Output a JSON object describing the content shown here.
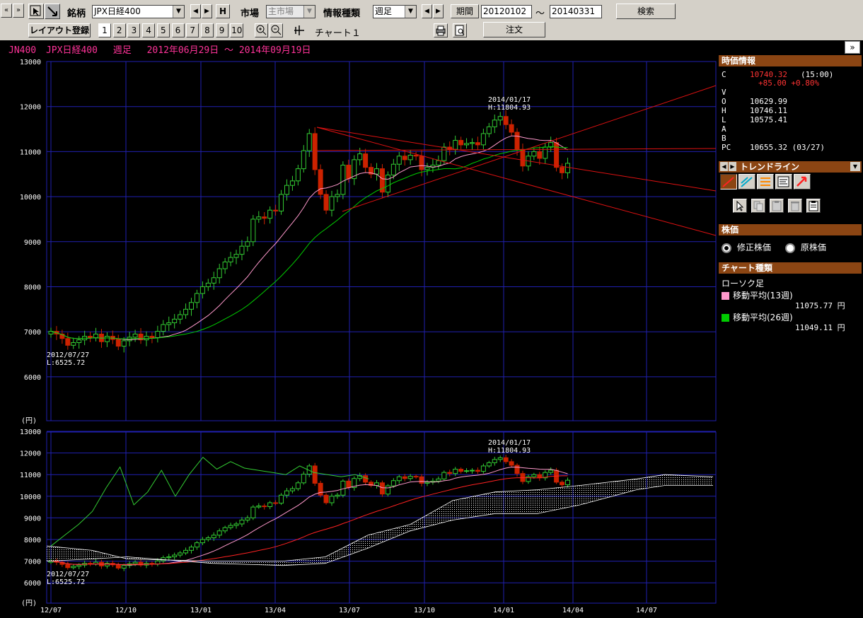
{
  "toolbar1": {
    "brand_label": "銘柄",
    "brand_value": "JPX日経400",
    "h_button": "H",
    "market_label": "市場",
    "market_value": "主市場",
    "info_label": "情報種類",
    "info_value": "週足",
    "period_label": "期間",
    "from_date": "20120102",
    "tilde": "～",
    "to_date": "20140331",
    "search_button": "検索"
  },
  "toolbar2": {
    "layout_button": "レイアウト登録",
    "layout_numbers": [
      "1",
      "2",
      "3",
      "4",
      "5",
      "6",
      "7",
      "8",
      "9",
      "10"
    ],
    "chart_label": "チャート１",
    "order_button": "注文"
  },
  "chart_header": {
    "code": "JN400",
    "name": "JPX日経400",
    "period_type": "週足",
    "date_range": "2012年06月29日 ～ 2014年09月19日"
  },
  "main_chart": {
    "y_ticks": [
      "13000",
      "12000",
      "11000",
      "10000",
      "9000",
      "8000",
      "7000",
      "6000"
    ],
    "unit": "(円)",
    "high_annotation_date": "2014/01/17",
    "high_annotation_value": "H:11804.93",
    "low_annotation_date": "2012/07/27",
    "low_annotation_value": "L:6525.72"
  },
  "sub_chart": {
    "y_ticks": [
      "13000",
      "12000",
      "11000",
      "10000",
      "9000",
      "8000",
      "7000",
      "6000"
    ],
    "unit": "(円)",
    "high_annotation_date": "2014/01/17",
    "high_annotation_value": "H:11804.93",
    "low_annotation_date": "2012/07/27",
    "low_annotation_value": "L:6525.72"
  },
  "x_axis": [
    "12/07",
    "12/10",
    "13/01",
    "13/04",
    "13/07",
    "13/10",
    "14/01",
    "14/04",
    "14/07"
  ],
  "right_panel": {
    "quote_header": "時価情報",
    "quote": {
      "c_label": "C",
      "c_value": "10740.32",
      "c_time": "(15:00)",
      "change": "+85.00 +0.80%",
      "v_label": "V",
      "o_label": "O",
      "o_value": "10629.99",
      "h_label": "H",
      "h_value": "10746.11",
      "l_label": "L",
      "l_value": "10575.41",
      "a_label": "A",
      "b_label": "B",
      "pc_label": "PC",
      "pc_value": "10655.32 (03/27)"
    },
    "trendline_header": "トレンドライン",
    "stock_price_header": "株価",
    "radio_adjusted": "修正株価",
    "radio_original": "原株価",
    "chart_type_header": "チャート種類",
    "candle_label": "ローソク足",
    "ma13_label": "移動平均(13週)",
    "ma13_value": "11075.77 円",
    "ma26_label": "移動平均(26週)",
    "ma26_value": "11049.11 円",
    "colors": {
      "ma13": "#ff99cc",
      "ma26": "#00cc00",
      "up": "#33cc33",
      "down": "#cc2200",
      "trend": "#cc0000",
      "header_bg": "#8b4513"
    }
  },
  "chart_data": [
    {
      "type": "candlestick",
      "title": "JN400 JPX日経400 週足 2012年06月29日 ～ 2014年09月19日",
      "ylim": [
        5000,
        13000
      ],
      "x_ticks": [
        "12/07",
        "12/10",
        "13/01",
        "13/04",
        "13/07",
        "13/10",
        "14/01",
        "14/04",
        "14/07"
      ],
      "closes": [
        7010,
        6950,
        6850,
        6700,
        6760,
        6820,
        6900,
        6870,
        6950,
        6780,
        6900,
        6830,
        6680,
        6800,
        6880,
        6950,
        6820,
        6900,
        6870,
        7010,
        7160,
        7200,
        7280,
        7380,
        7500,
        7650,
        7850,
        8000,
        8080,
        8200,
        8400,
        8550,
        8650,
        8720,
        8900,
        9000,
        9500,
        9550,
        9520,
        9700,
        9680,
        10050,
        10250,
        10350,
        10620,
        11020,
        11400,
        10600,
        10050,
        9700,
        10000,
        10050,
        10700,
        10400,
        10820,
        10950,
        10650,
        10500,
        10620,
        10100,
        10480,
        10720,
        10900,
        10820,
        10920,
        10900,
        10600,
        10650,
        10700,
        10800,
        11100,
        11050,
        11250,
        11150,
        11180,
        11200,
        11150,
        11400,
        11550,
        11700,
        11780,
        11600,
        11430,
        11050,
        10680,
        10900,
        11000,
        10850,
        11100,
        11200,
        10650,
        10530,
        10740
      ],
      "series": [
        {
          "name": "移動平均(13週)",
          "last": 11075.77
        },
        {
          "name": "移動平均(26週)",
          "last": 11049.11
        }
      ],
      "annotations": [
        {
          "date": "2014/01/17",
          "label": "H:11804.93"
        },
        {
          "date": "2012/07/27",
          "label": "L:6525.72"
        }
      ]
    },
    {
      "type": "line",
      "title": "",
      "ylim": [
        5500,
        13000
      ],
      "x_ticks": [
        "12/07",
        "12/10",
        "13/01",
        "13/04",
        "13/07",
        "13/10",
        "14/01",
        "14/04",
        "14/07"
      ],
      "series": [
        {
          "name": "",
          "values": [
            7700,
            8200,
            8700,
            9300,
            10400,
            11350,
            9600,
            10200,
            11200,
            10000,
            11000,
            11800,
            11250,
            11600,
            11300,
            11200,
            11100,
            11000,
            11400,
            11100,
            11000,
            10900,
            11000,
            10800
          ]
        }
      ],
      "annotations": [
        {
          "date": "2014/01/17",
          "label": "H:11804.93"
        },
        {
          "date": "2012/07/27",
          "label": "L:6525.72"
        }
      ]
    }
  ]
}
